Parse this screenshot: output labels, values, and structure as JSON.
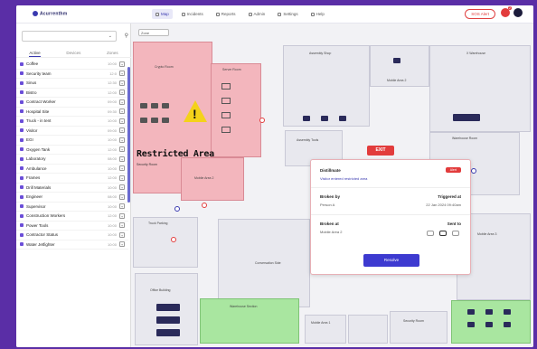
{
  "app": {
    "brand": "Acurrenthm"
  },
  "nav": [
    {
      "label": "Map"
    },
    {
      "label": "Incidents"
    },
    {
      "label": "Reports"
    },
    {
      "label": "Admin"
    },
    {
      "label": "Settings"
    },
    {
      "label": "Help"
    }
  ],
  "top": {
    "sos_label": "SOS Alert",
    "notification_count": "2"
  },
  "sidebar": {
    "select_value": "",
    "tabs": [
      "Active",
      "Devices",
      "Zones"
    ],
    "items": [
      {
        "name": "Coffee",
        "count": "10:00"
      },
      {
        "name": "Security team",
        "count": "12:0"
      },
      {
        "name": "Sinus",
        "count": "12:30"
      },
      {
        "name": "Bistro",
        "count": "12:00"
      },
      {
        "name": "Contract Worker",
        "count": "09:00"
      },
      {
        "name": "Hospital Site",
        "count": "09:30"
      },
      {
        "name": "Truck - in tent",
        "count": "10:00"
      },
      {
        "name": "Visitor",
        "count": "09:00"
      },
      {
        "name": "EGI",
        "count": "10:00"
      },
      {
        "name": "Oxygen Tank",
        "count": "12:00"
      },
      {
        "name": "Laboratory",
        "count": "08:00"
      },
      {
        "name": "Ambulance",
        "count": "10:00"
      },
      {
        "name": "Frames",
        "count": "12:00"
      },
      {
        "name": "Drill Materials",
        "count": "10:00"
      },
      {
        "name": "Engineer",
        "count": "08:00"
      },
      {
        "name": "Supervisor",
        "count": "10:00"
      },
      {
        "name": "Construction Workers",
        "count": "12:00"
      },
      {
        "name": "Power Tools",
        "count": "10:00"
      },
      {
        "name": "Contractor Status",
        "count": "10:00"
      },
      {
        "name": "Water Jetfighter",
        "count": "10:00"
      }
    ]
  },
  "map": {
    "zone_select": "Zone",
    "restricted_label": "Restricted Area",
    "restricted_sub": "Security Room",
    "exit_label": "EXIT",
    "rooms": {
      "r_office": "Crypto Room",
      "r_server": "Server Room",
      "r_assembly": "Assembly Shop",
      "r_lift": "Mobile Area 2",
      "r_warehouse": "X Warehouse",
      "r_assembly_tools": "Assembly Tools",
      "r_warehouse_room": "Warehouse Room",
      "r_power": "Mobile Area 3",
      "r_parking": "Truck Parking",
      "r_conversation": "Conversation Side",
      "r_office_building": "Office Building",
      "r_room4": "Room 4",
      "r_mobile1": "Mobile Area 1",
      "r_security": "Security Room",
      "r_green_area": "Warehouse Section"
    }
  },
  "popup": {
    "title": "Distillmate",
    "link": "Visitor entered restricted area",
    "badge": "Alert",
    "broken_by_label": "Broken by",
    "broken_by_value": "Person A",
    "triggered_label": "Triggered at",
    "triggered_value": "22 Jan 2024 09:40am",
    "broken_at_label": "Broken at",
    "broken_at_value": "Mobile Area 2",
    "sent_to_label": "Sent to",
    "resolve_label": "Resolve"
  }
}
